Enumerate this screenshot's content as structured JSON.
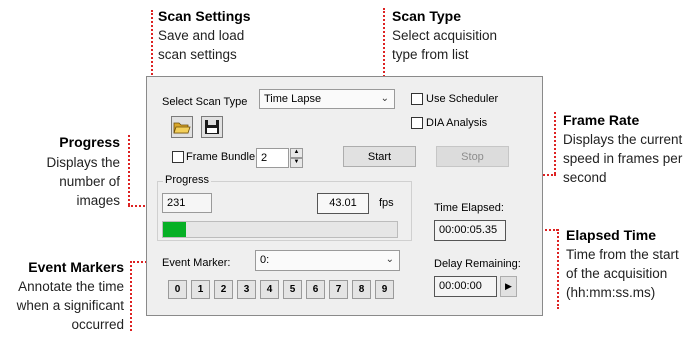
{
  "annotations": {
    "scan_settings": {
      "title": "Scan Settings",
      "lines": [
        "Save and load",
        "scan settings"
      ]
    },
    "scan_type": {
      "title": "Scan Type",
      "lines": [
        "Select acquisition",
        "type from list"
      ]
    },
    "frame_rate": {
      "title": "Frame Rate",
      "lines": [
        "Displays the current",
        "speed in frames per",
        "second"
      ]
    },
    "progress": {
      "title": "Progress",
      "lines": [
        "Displays the",
        "number of",
        "images"
      ]
    },
    "elapsed_time": {
      "title": "Elapsed Time",
      "lines": [
        "Time from the start",
        "of the acquisition",
        "(hh:mm:ss.ms)"
      ]
    },
    "event_markers": {
      "title": "Event Markers",
      "lines": [
        "Annotate the time",
        "when a significant",
        "occurred"
      ]
    }
  },
  "dialog": {
    "scan_type_label": "Select Scan Type",
    "scan_type_value": "Time Lapse",
    "use_scheduler_label": "Use Scheduler",
    "dia_analysis_label": "DIA Analysis",
    "frame_bundle_label": "Frame Bundle",
    "frame_bundle_value": "2",
    "start_label": "Start",
    "stop_label": "Stop",
    "progress_group_label": "Progress",
    "image_count": "231",
    "fps_value": "43.01",
    "fps_unit": "fps",
    "progress_fraction": 0.1,
    "time_elapsed_label": "Time Elapsed:",
    "time_elapsed_value": "00:00:05.35",
    "event_marker_label": "Event Marker:",
    "event_marker_value": "0:",
    "delay_remaining_label": "Delay Remaining:",
    "delay_remaining_value": "00:00:00",
    "event_keys": [
      "0",
      "1",
      "2",
      "3",
      "4",
      "5",
      "6",
      "7",
      "8",
      "9"
    ]
  },
  "colors": {
    "leader": "#d22222",
    "progress_fill": "#06b025"
  },
  "icons": [
    "open-folder-icon",
    "save-disk-icon",
    "chevron-down-icon",
    "play-arrow-icon"
  ]
}
